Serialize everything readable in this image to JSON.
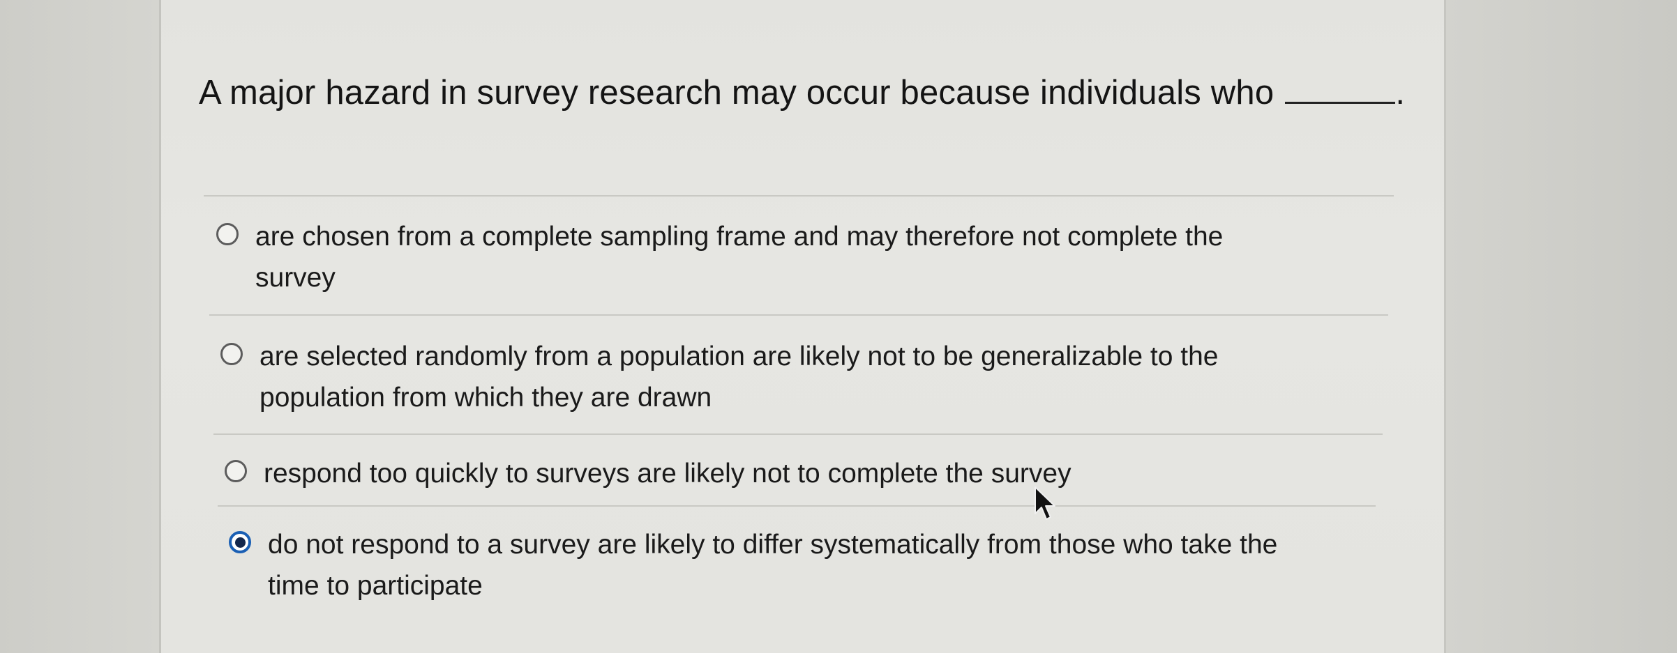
{
  "question": {
    "text": "A major hazard in survey research may occur because individuals who",
    "end_punct": "."
  },
  "options": [
    {
      "line1": "are chosen from a complete sampling frame and may therefore not complete the",
      "line2": "survey",
      "selected": false
    },
    {
      "line1": "are selected randomly from a population are likely not to be generalizable to the",
      "line2": "population from which they are drawn",
      "selected": false
    },
    {
      "line1": "respond too quickly to surveys are likely not to complete the survey",
      "line2": "",
      "selected": false
    },
    {
      "line1": "do not respond to a survey are likely to differ systematically from those who take the",
      "line2": "time to participate",
      "selected": true
    }
  ],
  "colors": {
    "accent": "#1a5fb4",
    "text": "#1a1a1a"
  },
  "icons": [
    "radio-unchecked-icon",
    "radio-checked-icon",
    "mouse-pointer-icon"
  ]
}
